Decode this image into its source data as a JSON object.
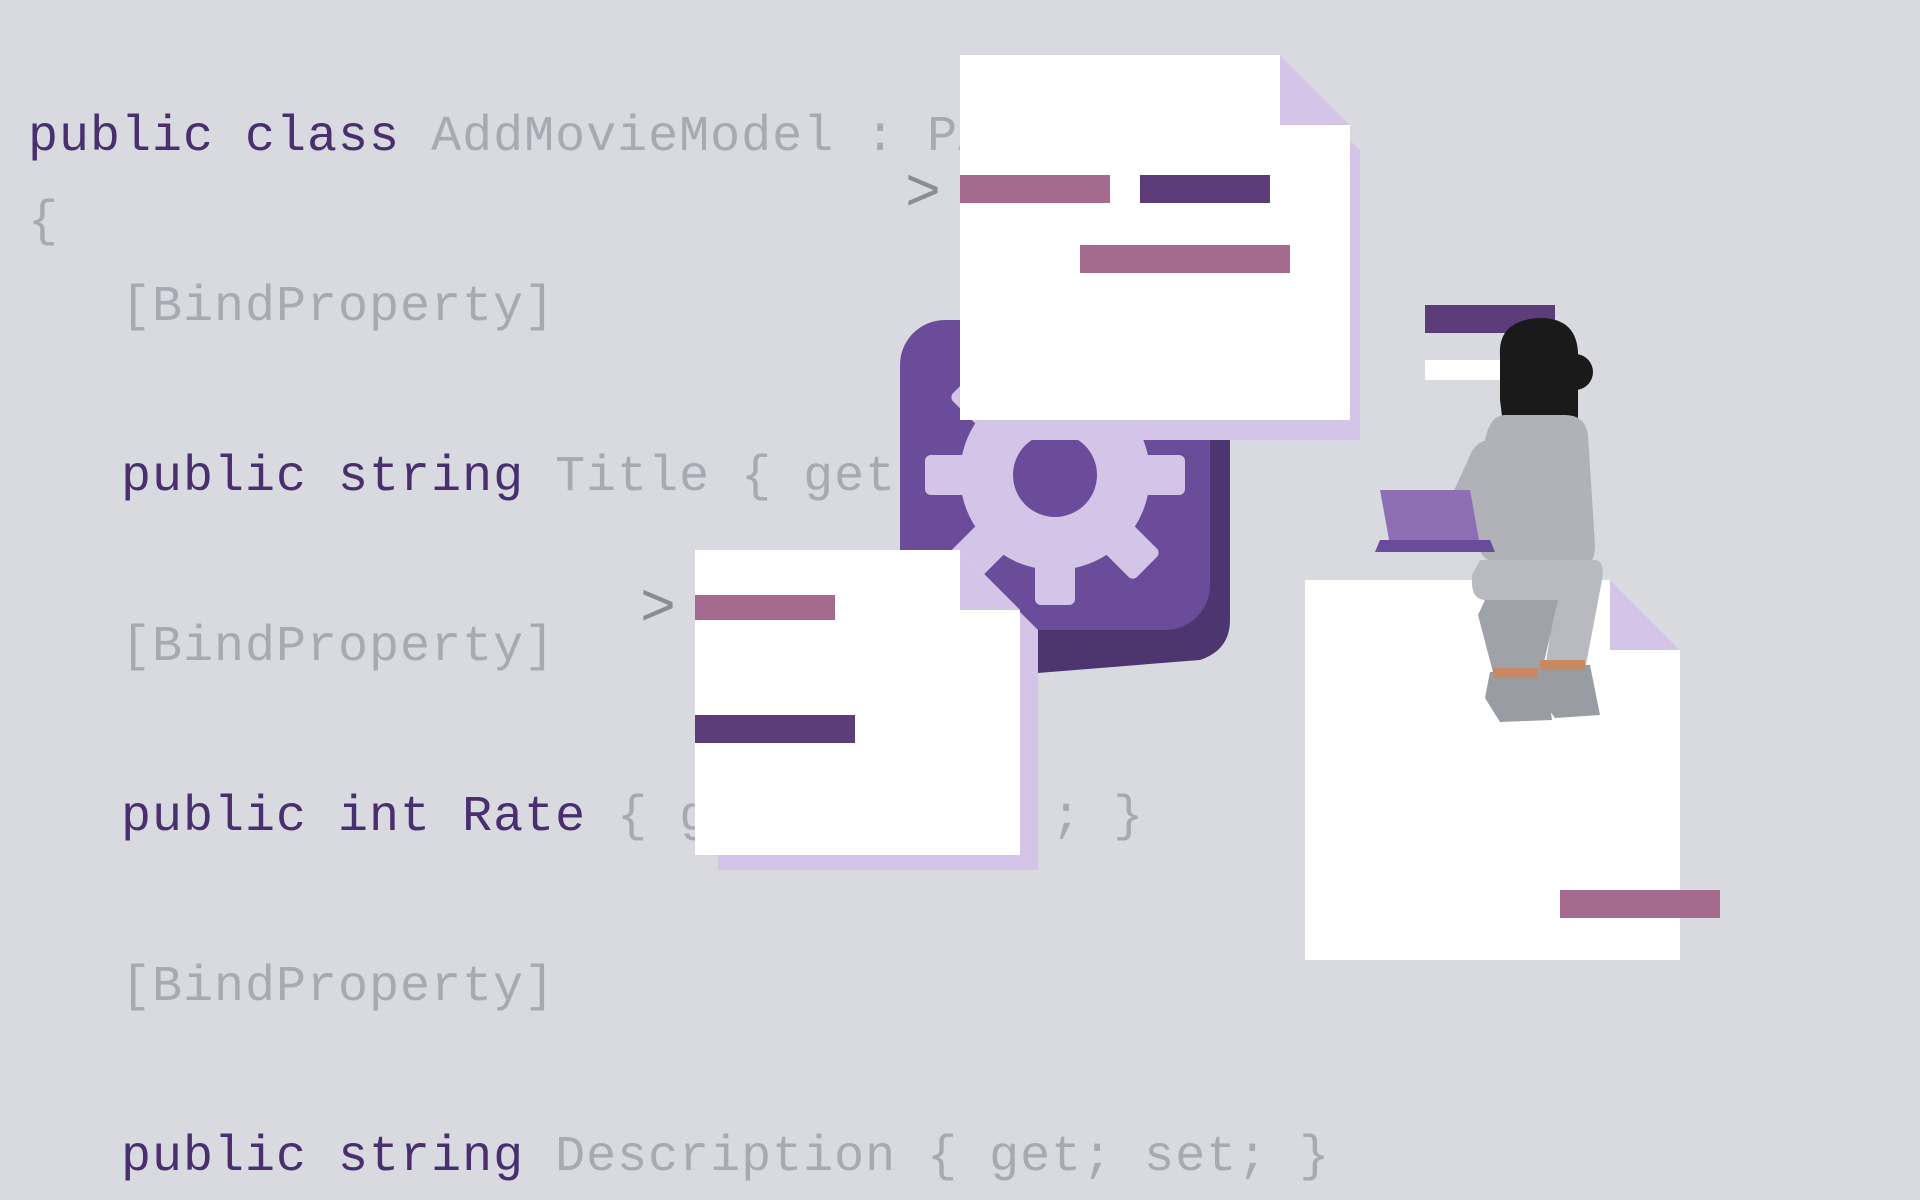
{
  "code": {
    "line1_kw": "public class ",
    "line1_rest": "AddMovieModel : PAgeModel",
    "line2": "{",
    "line3": "   [BindProperty]",
    "line4_kw": "   public string ",
    "line4_rest": "Title { get",
    "line5": "   [BindProperty]",
    "line6_kw": "   public int Rate ",
    "line6_rest": "{ g           ; }",
    "line7": "   [BindProperty]",
    "line8_kw": "   public string ",
    "line8_rest": "Description { get; set; }"
  },
  "colors": {
    "keyword": "#4a2f6f",
    "faded": "#a8a9b3",
    "background": "#d8dae0",
    "gear_box": "#6b4c9a",
    "gear": "#d4c5e8",
    "accent_pink": "#a56b8e",
    "accent_purple": "#5c3d7a"
  }
}
